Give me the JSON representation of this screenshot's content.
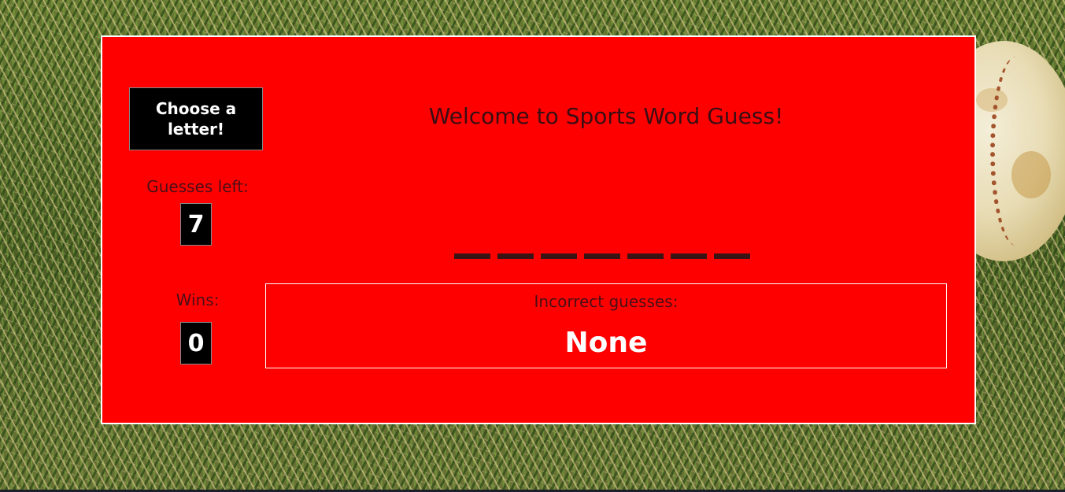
{
  "game": {
    "choose_button_label": "Choose a letter!",
    "welcome_title": "Welcome to Sports Word Guess!",
    "guesses_left_label": "Guesses left:",
    "guesses_left_value": "7",
    "wins_label": "Wins:",
    "wins_value": "0",
    "word_blank_count": 7,
    "incorrect_label": "Incorrect guesses:",
    "incorrect_value": "None"
  },
  "colors": {
    "panel": "#ff0000",
    "panel_border": "#ffffff",
    "box": "#000000",
    "heading_text": "#3a0e14",
    "value_text": "#ffffff"
  },
  "background": {
    "icon": "grass-texture",
    "decoration_icon": "baseball-icon"
  }
}
